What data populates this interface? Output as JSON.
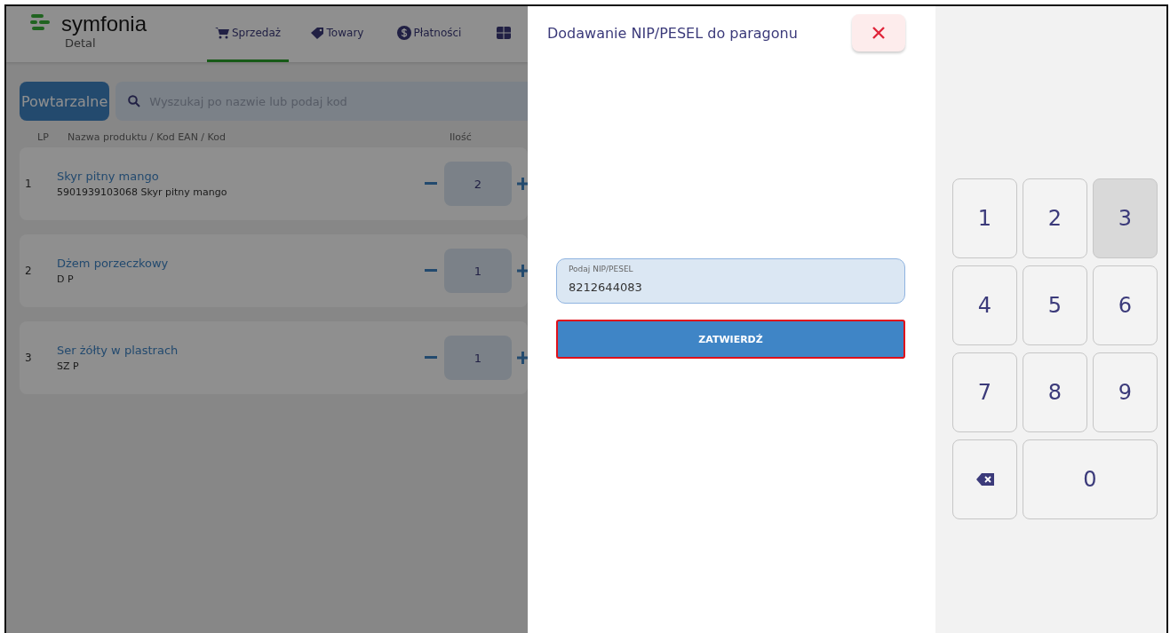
{
  "app": {
    "logo": {
      "name": "symfonia",
      "subtitle": "Detal"
    },
    "tabs": [
      {
        "label": "Sprzedaż",
        "selected": true
      },
      {
        "label": "Towary",
        "selected": false
      },
      {
        "label": "Płatności",
        "selected": false
      },
      {
        "selected": false
      }
    ],
    "repeat_button": "Powtarzalne",
    "search": {
      "placeholder": "Wyszukaj po nazwie lub podaj kod"
    },
    "columns": [
      "LP",
      "Nazwa produktu / Kod EAN / Kod",
      "Ilość"
    ],
    "rows": [
      {
        "lp": "1",
        "name": "Skyr pitny mango",
        "code": "5901939103068 Skyr pitny mango",
        "qty": "2"
      },
      {
        "lp": "2",
        "name": "Dżem porzeczkowy",
        "code": "D P",
        "qty": "1"
      },
      {
        "lp": "3",
        "name": "Ser żółty w plastrach",
        "code": "SZ P",
        "qty": "1"
      }
    ]
  },
  "dialog": {
    "title": "Dodawanie NIP/PESEL do paragonu",
    "field": {
      "label": "Podaj NIP/PESEL",
      "value": "8212644083"
    },
    "confirm": {
      "label": "ZATWIERDŹ",
      "highlighted": true
    }
  },
  "keypad": [
    {
      "kind": "digit",
      "label": "1",
      "pressed": false
    },
    {
      "kind": "digit",
      "label": "2",
      "pressed": false
    },
    {
      "kind": "digit",
      "label": "3",
      "pressed": true
    },
    {
      "kind": "digit",
      "label": "4",
      "pressed": false
    },
    {
      "kind": "digit",
      "label": "5",
      "pressed": false
    },
    {
      "kind": "digit",
      "label": "6",
      "pressed": false
    },
    {
      "kind": "digit",
      "label": "7",
      "pressed": false
    },
    {
      "kind": "digit",
      "label": "8",
      "pressed": false
    },
    {
      "kind": "digit",
      "label": "9",
      "pressed": false
    },
    {
      "kind": "backspace",
      "pressed": false
    },
    {
      "kind": "wide",
      "label": "0",
      "pressed": false
    }
  ]
}
